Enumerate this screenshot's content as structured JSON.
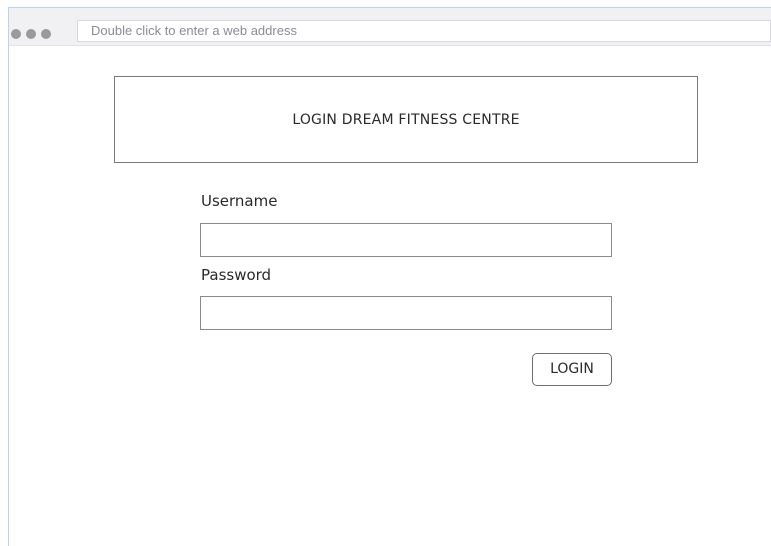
{
  "browser": {
    "address_bar_placeholder": "Double click to enter a web address",
    "window_dots": [
      "dot",
      "dot",
      "dot"
    ]
  },
  "login_page": {
    "title": "LOGIN DREAM FITNESS CENTRE",
    "username_label": "Username",
    "username_value": "",
    "password_label": "Password",
    "password_value": "",
    "login_button_label": "LOGIN"
  },
  "colors": {
    "frame_border": "#b8d4ee",
    "toolbar_bg": "#f1f1f3",
    "dot": "#9a9a9a",
    "field_border": "#8a8a8a",
    "text": "#2a2a2a"
  }
}
